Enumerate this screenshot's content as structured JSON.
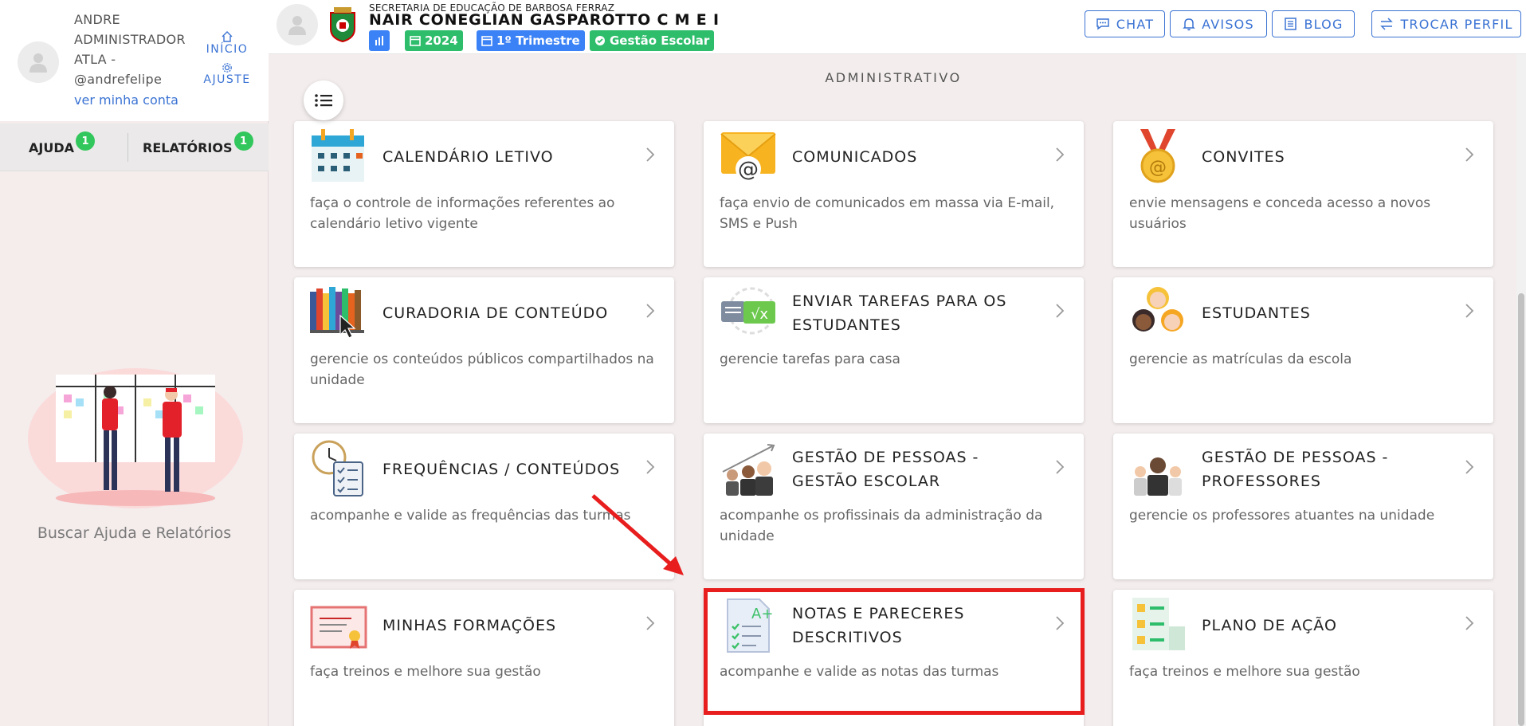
{
  "user": {
    "name": "ANDRE ADMINISTRADOR ATLA -",
    "handle": "@andrefelipe",
    "account_link": "ver minha conta"
  },
  "mini_nav": {
    "inicio": "INÍCIO",
    "ajuste": "AJUSTE"
  },
  "sidebar_tabs": [
    {
      "label": "AJUDA",
      "badge": "1"
    },
    {
      "label": "RELATÓRIOS",
      "badge": "1"
    }
  ],
  "sidebar": {
    "help_text": "Buscar Ajuda e Relatórios"
  },
  "header": {
    "secretaria": "SECRETARIA DE EDUCAÇÃO DE BARBOSA FERRAZ",
    "school": "NAIR CONEGLIAN GASPAROTTO C M E I",
    "year": "2024",
    "period": "1º Trimestre",
    "gestao": "Gestão Escolar",
    "buttons": {
      "chat": "CHAT",
      "avisos": "AVISOS",
      "blog": "BLOG",
      "trocar": "TROCAR PERFIL"
    }
  },
  "section_title": "ADMINISTRATIVO",
  "cards": [
    {
      "title": "CALENDÁRIO LETIVO",
      "desc": "faça o controle de informações referentes ao calendário letivo vigente",
      "icon": "calendar-icon"
    },
    {
      "title": "COMUNICADOS",
      "desc": "faça envio de comunicados em massa via E-mail, SMS e Push",
      "icon": "envelope-icon"
    },
    {
      "title": "CONVITES",
      "desc": "envie mensagens e conceda acesso a novos usuários",
      "icon": "medal-icon"
    },
    {
      "title": "CURADORIA DE CONTEÚDO",
      "desc": "gerencie os conteúdos públicos compartilhados na unidade",
      "icon": "books-icon"
    },
    {
      "title": "ENVIAR TAREFAS PARA OS ESTUDANTES",
      "desc": "gerencie tarefas para casa",
      "icon": "homework-icon"
    },
    {
      "title": "ESTUDANTES",
      "desc": "gerencie as matrículas da escola",
      "icon": "students-icon"
    },
    {
      "title": "FREQUÊNCIAS / CONTEÚDOS",
      "desc": "acompanhe e valide as frequências das turmas",
      "icon": "attendance-icon"
    },
    {
      "title": "GESTÃO DE PESSOAS - GESTÃO ESCOLAR",
      "desc": "acompanhe os profissinais da administração da unidade",
      "icon": "people-growth-icon"
    },
    {
      "title": "GESTÃO DE PESSOAS - PROFESSORES",
      "desc": "gerencie os professores atuantes na unidade",
      "icon": "teachers-icon"
    },
    {
      "title": "MINHAS FORMAÇÕES",
      "desc": "faça treinos e melhore sua gestão",
      "icon": "certificate-icon"
    },
    {
      "title": "NOTAS E PARECERES DESCRITIVOS",
      "desc": "acompanhe e valide as notas das turmas",
      "icon": "grades-icon"
    },
    {
      "title": "PLANO DE AÇÃO",
      "desc": "faça treinos e melhore sua gestão",
      "icon": "checklist-icon"
    }
  ],
  "colors": {
    "accent": "#3b73d4",
    "green": "#2ebd6b",
    "highlight": "#e81d1d"
  }
}
